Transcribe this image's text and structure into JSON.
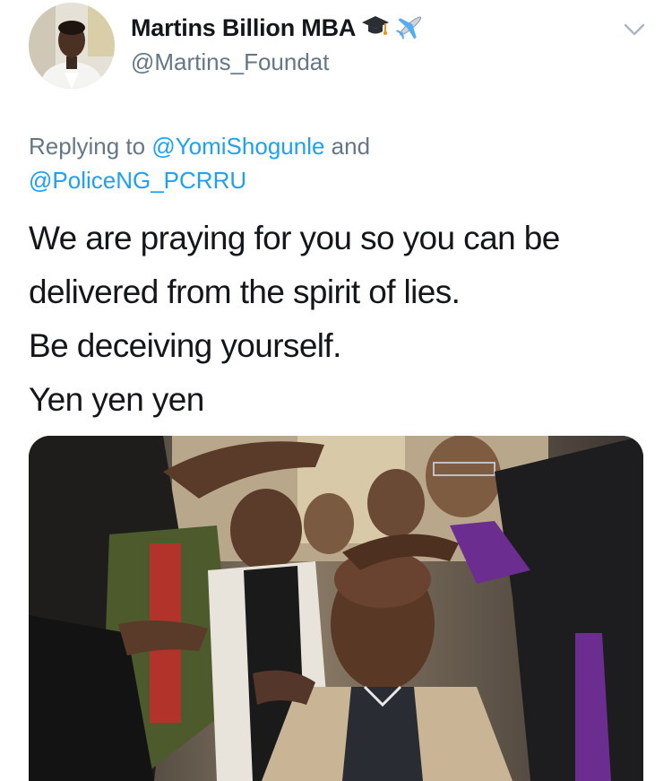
{
  "author": {
    "display_name": "Martins Billion MBA",
    "handle": "@Martins_Foundat",
    "badge_icons": [
      "graduation-cap-icon",
      "airplane-icon"
    ]
  },
  "reply_context": {
    "prefix": "Replying to ",
    "mention_1": "@YomiShogunle",
    "conjunction": " and",
    "mention_2": "@PoliceNG_PCRRU"
  },
  "tweet": {
    "lines": [
      "We are praying for you so you can be",
      "delivered from the spirit of lies.",
      "Be deceiving yourself.",
      "Yen yen yen"
    ]
  },
  "media": {
    "kind": "photo",
    "icon": "photo-image"
  },
  "colors": {
    "text": "#14171a",
    "secondary": "#657786",
    "link": "#1da1f2",
    "caret": "#aab8c2"
  }
}
